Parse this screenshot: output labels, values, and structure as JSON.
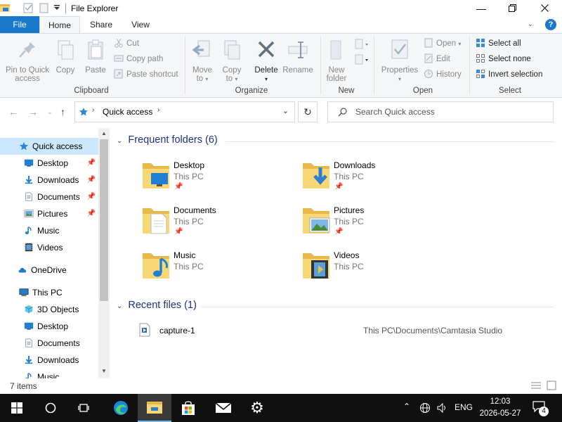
{
  "titlebar": {
    "title": "File Explorer",
    "minimize_icon": "minimize-icon",
    "maximize_icon": "maximize-icon",
    "close_icon": "close-icon"
  },
  "ribbon_tabs": {
    "file": "File",
    "home": "Home",
    "share": "Share",
    "view": "View",
    "help": "?"
  },
  "ribbon": {
    "clipboard": {
      "label": "Clipboard",
      "pin_to_quick_access": "Pin to Quick access",
      "pin_line1": "Pin to Quick",
      "pin_line2": "access",
      "copy": "Copy",
      "paste": "Paste",
      "cut": "Cut",
      "copy_path": "Copy path",
      "paste_shortcut": "Paste shortcut"
    },
    "organize": {
      "label": "Organize",
      "move_to_line1": "Move",
      "move_to_line2": "to",
      "copy_to_line1": "Copy",
      "copy_to_line2": "to",
      "delete": "Delete",
      "rename": "Rename"
    },
    "new": {
      "label": "New",
      "new_folder_line1": "New",
      "new_folder_line2": "folder"
    },
    "open": {
      "label": "Open",
      "properties": "Properties",
      "open": "Open",
      "edit": "Edit",
      "history": "History"
    },
    "select": {
      "label": "Select",
      "select_all": "Select all",
      "select_none": "Select none",
      "invert_selection": "Invert selection"
    }
  },
  "address": {
    "path": "Quick access",
    "search_placeholder": "Search Quick access"
  },
  "nav_pane": {
    "items": [
      {
        "label": "Quick access",
        "icon": "star-icon",
        "pinned": false
      },
      {
        "label": "Desktop",
        "icon": "desktop-icon",
        "pinned": true
      },
      {
        "label": "Downloads",
        "icon": "downloads-icon",
        "pinned": true
      },
      {
        "label": "Documents",
        "icon": "documents-icon",
        "pinned": true
      },
      {
        "label": "Pictures",
        "icon": "pictures-icon",
        "pinned": true
      },
      {
        "label": "Music",
        "icon": "music-icon",
        "pinned": false
      },
      {
        "label": "Videos",
        "icon": "videos-icon",
        "pinned": false
      },
      {
        "label": "OneDrive",
        "icon": "cloud-icon",
        "pinned": false
      },
      {
        "label": "This PC",
        "icon": "computer-icon",
        "pinned": false
      },
      {
        "label": "3D Objects",
        "icon": "cube-icon",
        "pinned": false
      },
      {
        "label": "Desktop",
        "icon": "desktop-icon",
        "pinned": false
      },
      {
        "label": "Documents",
        "icon": "documents-icon",
        "pinned": false
      },
      {
        "label": "Downloads",
        "icon": "downloads-icon",
        "pinned": false
      },
      {
        "label": "Music",
        "icon": "music-icon",
        "pinned": false
      }
    ]
  },
  "content": {
    "frequent_header": "Frequent folders (6)",
    "recent_header": "Recent files (1)",
    "folders": [
      {
        "name": "Desktop",
        "location": "This PC",
        "pinned": true
      },
      {
        "name": "Downloads",
        "location": "This PC",
        "pinned": true
      },
      {
        "name": "Documents",
        "location": "This PC",
        "pinned": true
      },
      {
        "name": "Pictures",
        "location": "This PC",
        "pinned": true
      },
      {
        "name": "Music",
        "location": "This PC",
        "pinned": false
      },
      {
        "name": "Videos",
        "location": "This PC",
        "pinned": false
      }
    ],
    "recent_files": [
      {
        "name": "capture-1",
        "path": "This PC\\Documents\\Camtasia Studio"
      }
    ]
  },
  "status": {
    "items_count": "7 items"
  },
  "taskbar": {
    "language": "ENG",
    "time": "12:03",
    "date": "2026-05-27",
    "notification_count": "4"
  },
  "colors": {
    "accent": "#1979ca",
    "selection": "#cce8ff",
    "section_header": "#1e3287",
    "folder_yellow": "#f8d775",
    "taskbar": "#101010"
  }
}
